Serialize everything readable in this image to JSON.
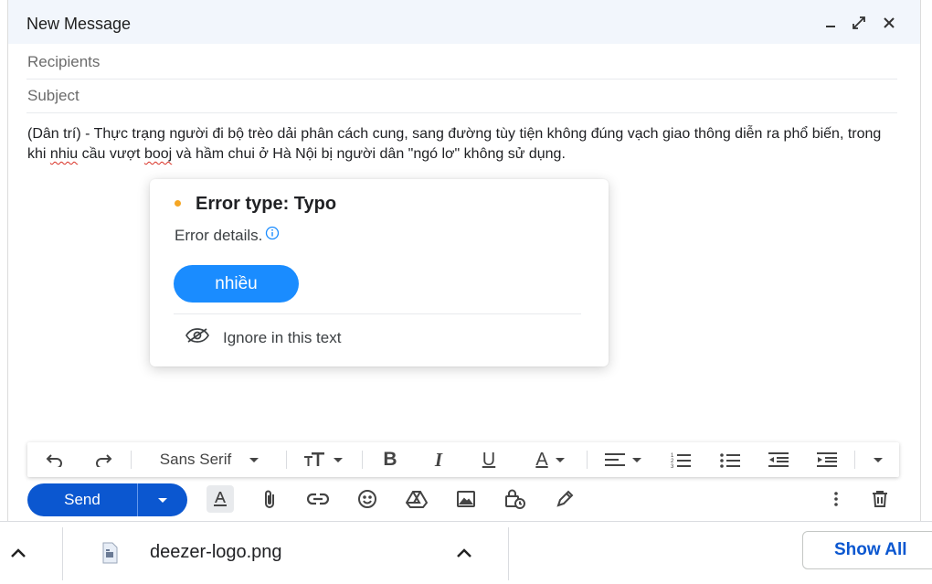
{
  "compose": {
    "title": "New Message",
    "recipients_placeholder": "Recipients",
    "subject_placeholder": "Subject",
    "body": {
      "text_1": "(Dân trí) - Thực trạng người đi bộ trèo dải phân cách cung, sang đường tùy tiện không đúng vạch giao thông diễn ra phổ biến, trong khi ",
      "typo_1": "nhiu",
      "text_2": " cầu vượt ",
      "typo_2": "booj",
      "text_3": " và hầm chui ở Hà Nội bị người dân \"ngó lơ\" không sử dụng."
    }
  },
  "popup": {
    "title": "Error type: Typo",
    "details": "Error details.",
    "suggestion": "nhiều",
    "ignore": "Ignore in this text",
    "dot_color": "#f5a623",
    "accent_color": "#1a8cff"
  },
  "toolbar": {
    "font": "Sans Serif",
    "bold": "B",
    "italic": "I",
    "underline": "U",
    "text_color": "A"
  },
  "send": {
    "label": "Send",
    "color": "#0b57d0"
  },
  "downloads": {
    "file_name": "deezer-logo.png",
    "show_all": "Show All"
  },
  "icons": [
    "minimize-icon",
    "expand-icon",
    "close-icon",
    "undo-icon",
    "redo-icon",
    "text-size-icon",
    "align-icon",
    "numbered-list-icon",
    "bulleted-list-icon",
    "indent-less-icon",
    "indent-more-icon",
    "more-formatting-icon",
    "formatting-options-icon",
    "attach-icon",
    "link-icon",
    "emoji-icon",
    "drive-icon",
    "photo-icon",
    "confidential-icon",
    "signature-icon",
    "more-options-icon",
    "trash-icon",
    "chevron-up-icon",
    "file-icon",
    "eye-slash-icon",
    "info-icon"
  ]
}
